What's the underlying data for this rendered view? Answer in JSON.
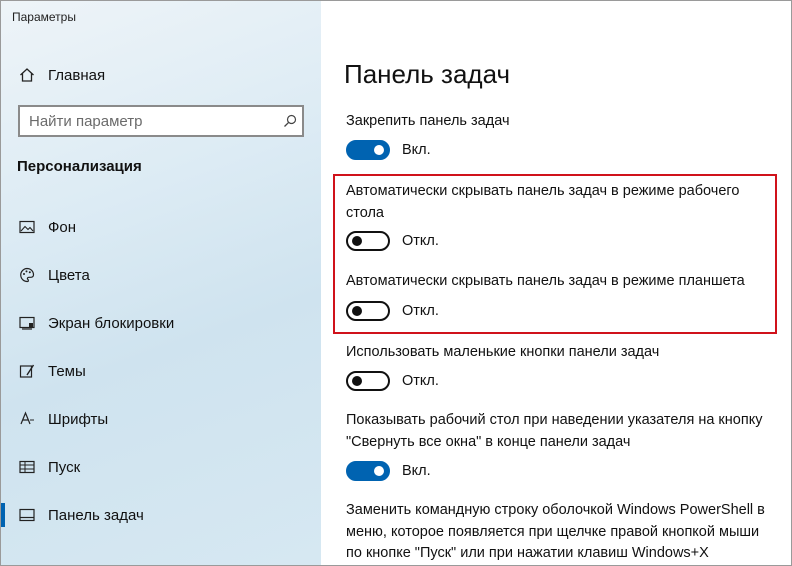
{
  "window": {
    "title": "Параметры"
  },
  "sidebar": {
    "home_label": "Главная",
    "search": {
      "placeholder": "Найти параметр",
      "value": ""
    },
    "section_title": "Персонализация",
    "items": [
      {
        "label": "Фон",
        "icon": "image-icon"
      },
      {
        "label": "Цвета",
        "icon": "palette-icon"
      },
      {
        "label": "Экран блокировки",
        "icon": "lock-screen-icon"
      },
      {
        "label": "Темы",
        "icon": "themes-icon"
      },
      {
        "label": "Шрифты",
        "icon": "fonts-icon"
      },
      {
        "label": "Пуск",
        "icon": "start-icon"
      },
      {
        "label": "Панель задач",
        "icon": "taskbar-icon",
        "active": true
      }
    ]
  },
  "main": {
    "title": "Панель задач",
    "settings": [
      {
        "label": "Закрепить панель задач",
        "state": "on",
        "state_label": "Вкл."
      },
      {
        "label": "Автоматически скрывать панель задач в режиме рабочего стола",
        "state": "off",
        "state_label": "Откл."
      },
      {
        "label": "Автоматически скрывать панель задач в режиме планшета",
        "state": "off",
        "state_label": "Откл."
      },
      {
        "label": "Использовать маленькие кнопки панели задач",
        "state": "off",
        "state_label": "Откл."
      },
      {
        "label": "Показывать рабочий стол при наведении указателя на кнопку \"Свернуть все окна\" в конце панели задач",
        "state": "on",
        "state_label": "Вкл."
      },
      {
        "label": "Заменить командную строку оболочкой Windows PowerShell в меню, которое появляется при щелчке правой кнопкой мыши по кнопке \"Пуск\" или при нажатии клавиш Windows+X"
      }
    ]
  },
  "colors": {
    "accent": "#0063b1",
    "highlight": "#d0121b"
  }
}
